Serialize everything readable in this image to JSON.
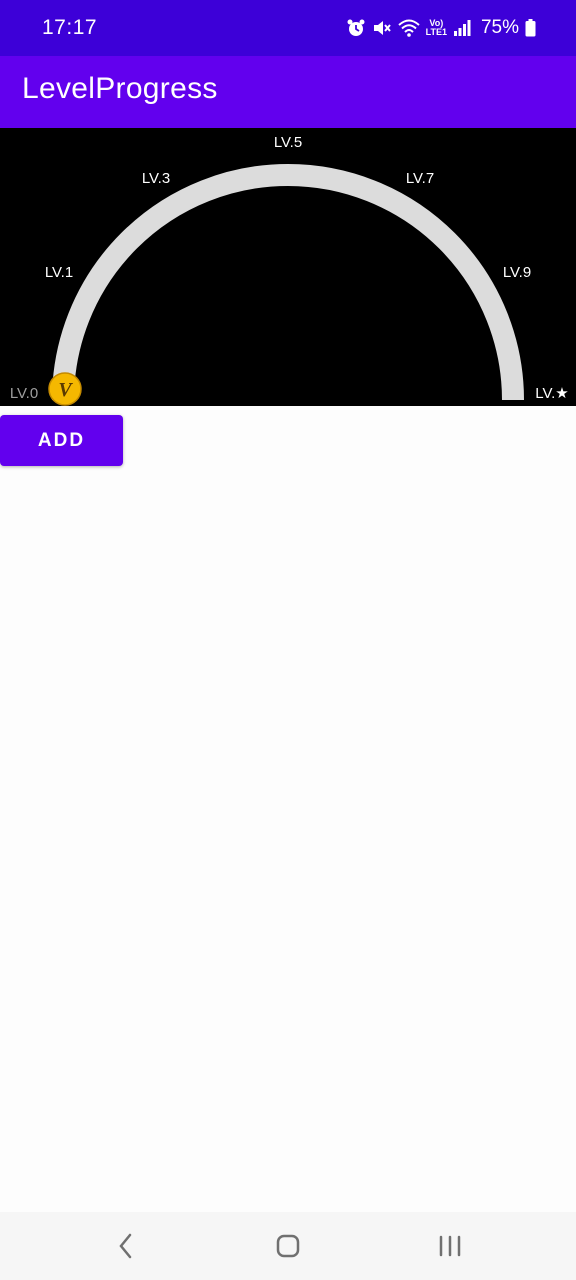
{
  "status_bar": {
    "time": "17:17",
    "icons": [
      "alarm-icon",
      "mute-icon",
      "wifi-icon",
      "volte-icon",
      "signal-icon",
      "battery-icon"
    ],
    "volte_top": "Vo)",
    "volte_bottom": "LTE1",
    "battery_percent": "75%"
  },
  "app_bar": {
    "title": "LevelProgress"
  },
  "level_gauge": {
    "labels": [
      "LV.0",
      "LV.1",
      "LV.3",
      "LV.5",
      "LV.7",
      "LV.9",
      "LV.★"
    ],
    "progress": 0,
    "badge_letter": "V",
    "colors": {
      "track": "#dcdcdc",
      "start_label": "#9e9e9e",
      "label": "#ffffff",
      "badge": "#f5b800",
      "badge_text": "#5a3a00",
      "background": "#000000"
    }
  },
  "actions": {
    "add_label": "ADD"
  },
  "nav_bar": {
    "items": [
      "back-icon",
      "home-icon",
      "recents-icon"
    ]
  },
  "theme": {
    "status_bar_color": "#3d00d8",
    "primary_color": "#6200ee"
  }
}
